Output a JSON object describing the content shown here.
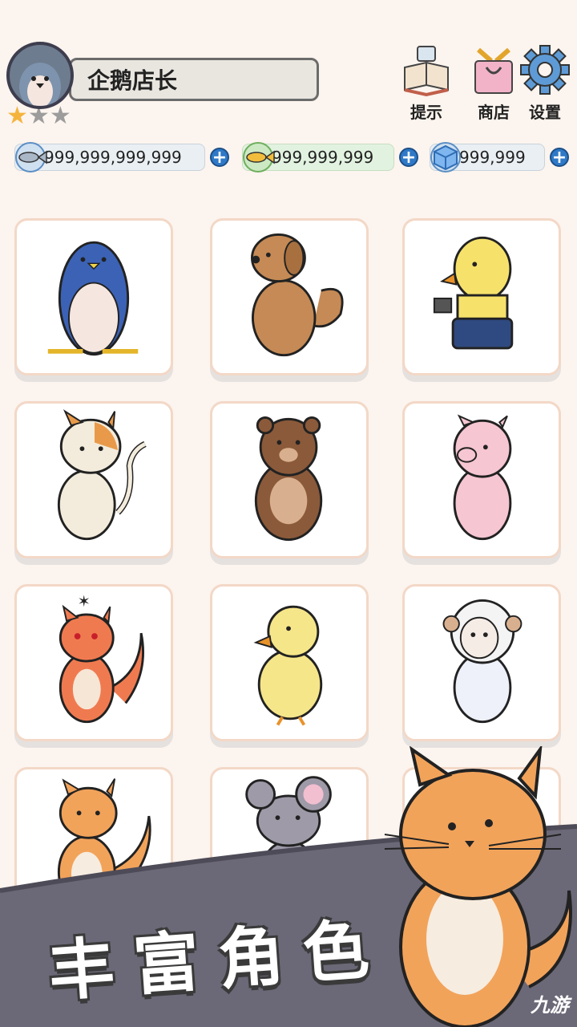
{
  "player": {
    "name": "企鹅店长",
    "stars_filled": 1,
    "stars_total": 3
  },
  "toolbar": {
    "hint_label": "提示",
    "shop_label": "商店",
    "settings_label": "设置"
  },
  "currencies": [
    {
      "name": "fish-coin",
      "value": "999,999,999,999"
    },
    {
      "name": "golden-fish",
      "value": "999,999,999"
    },
    {
      "name": "ice-cube",
      "value": "999,999"
    }
  ],
  "characters": [
    "penguin",
    "dog",
    "chick-with-coffee",
    "cat",
    "bear",
    "pig",
    "angry-fox",
    "duckling",
    "sheep",
    "fox",
    "mouse",
    "fox-mascot"
  ],
  "banner": {
    "title": "丰富角色"
  },
  "watermark": "九游",
  "colors": {
    "background": "#fcf4ee",
    "card_border": "#f3d8c7",
    "accent_blue": "#2f79c7"
  }
}
